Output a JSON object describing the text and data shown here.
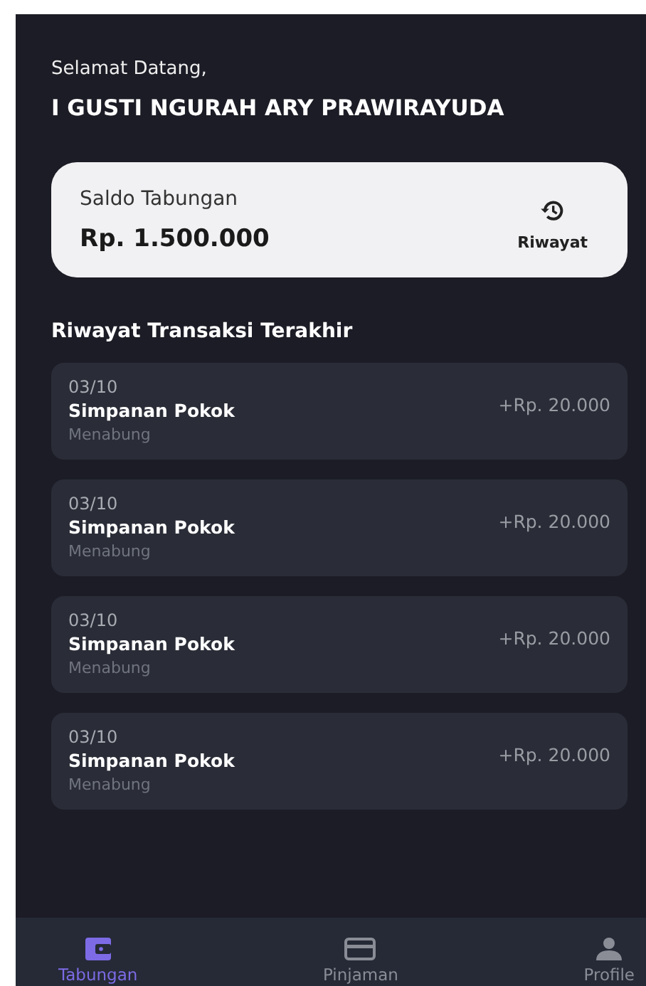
{
  "greeting": "Selamat Datang,",
  "user_name": "I GUSTI NGURAH ARY PRAWIRAYUDA",
  "balance_card": {
    "label": "Saldo Tabungan",
    "amount": "Rp. 1.500.000",
    "history_button": "Riwayat"
  },
  "section_title": "Riwayat Transaksi Terakhir",
  "transactions": [
    {
      "date": "03/10",
      "title": "Simpanan Pokok",
      "type": "Menabung",
      "amount": "+Rp. 20.000"
    },
    {
      "date": "03/10",
      "title": "Simpanan Pokok",
      "type": "Menabung",
      "amount": "+Rp. 20.000"
    },
    {
      "date": "03/10",
      "title": "Simpanan Pokok",
      "type": "Menabung",
      "amount": "+Rp. 20.000"
    },
    {
      "date": "03/10",
      "title": "Simpanan Pokok",
      "type": "Menabung",
      "amount": "+Rp. 20.000"
    }
  ],
  "bottom_nav": [
    {
      "kind": "wallet",
      "label": "Tabungan",
      "selected": true
    },
    {
      "kind": "card",
      "label": "Pinjaman",
      "selected": false
    },
    {
      "kind": "person",
      "label": "Profile",
      "selected": false
    }
  ]
}
